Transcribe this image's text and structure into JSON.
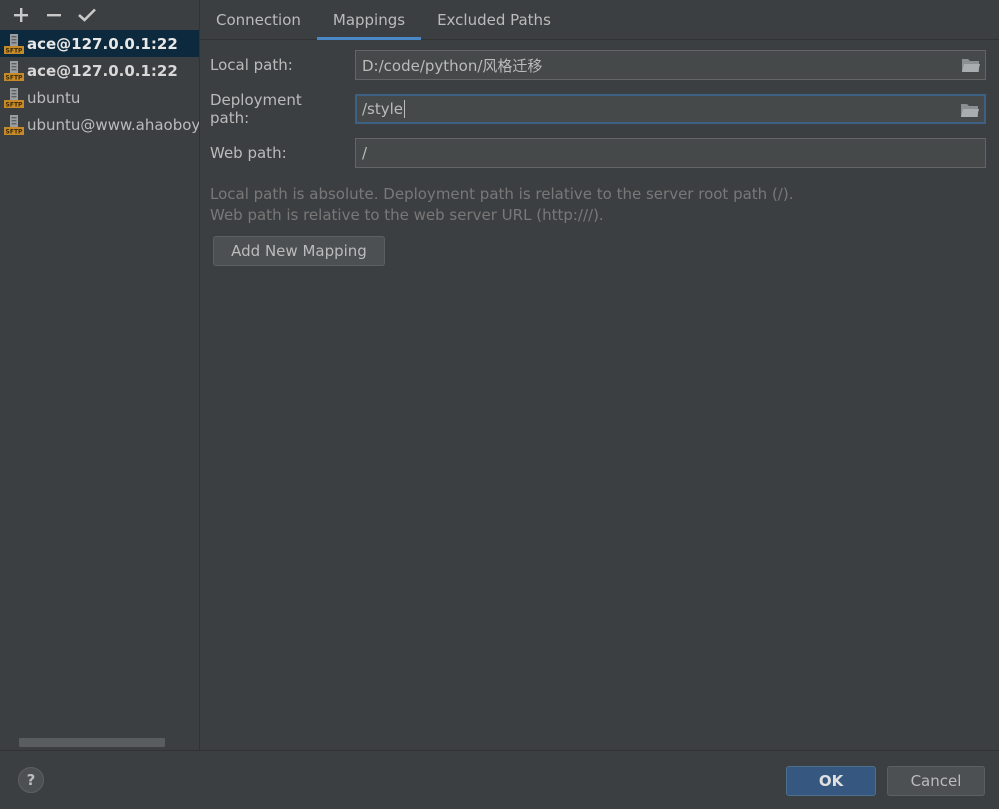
{
  "toolbar": {
    "add_label": "+",
    "remove_label": "−",
    "apply_label": "✓"
  },
  "servers": [
    {
      "name": "ace@127.0.0.1:22",
      "selected": true
    },
    {
      "name": "ace@127.0.0.1:22",
      "selected": false
    },
    {
      "name": "ubuntu",
      "selected": false
    },
    {
      "name": "ubuntu@www.ahaoboy.",
      "selected": false
    }
  ],
  "tabs": [
    {
      "label": "Connection",
      "active": false
    },
    {
      "label": "Mappings",
      "active": true
    },
    {
      "label": "Excluded Paths",
      "active": false
    }
  ],
  "form": {
    "local_path_label": "Local path:",
    "local_path_value": "D:/code/python/风格迁移",
    "deployment_path_label": "Deployment path:",
    "deployment_path_value": "/style",
    "web_path_label": "Web path:",
    "web_path_value": "/"
  },
  "hint": {
    "line1": "Local path is absolute. Deployment path is relative to the server root path (/).",
    "line2": "Web path is relative to the web server URL (http:///)."
  },
  "add_mapping_label": "Add New Mapping",
  "footer": {
    "help_label": "?",
    "ok_label": "OK",
    "cancel_label": "Cancel"
  },
  "colors": {
    "background": "#3c3f41",
    "selection": "#0d293e",
    "accent": "#4a88c7",
    "ok_button": "#365880"
  }
}
